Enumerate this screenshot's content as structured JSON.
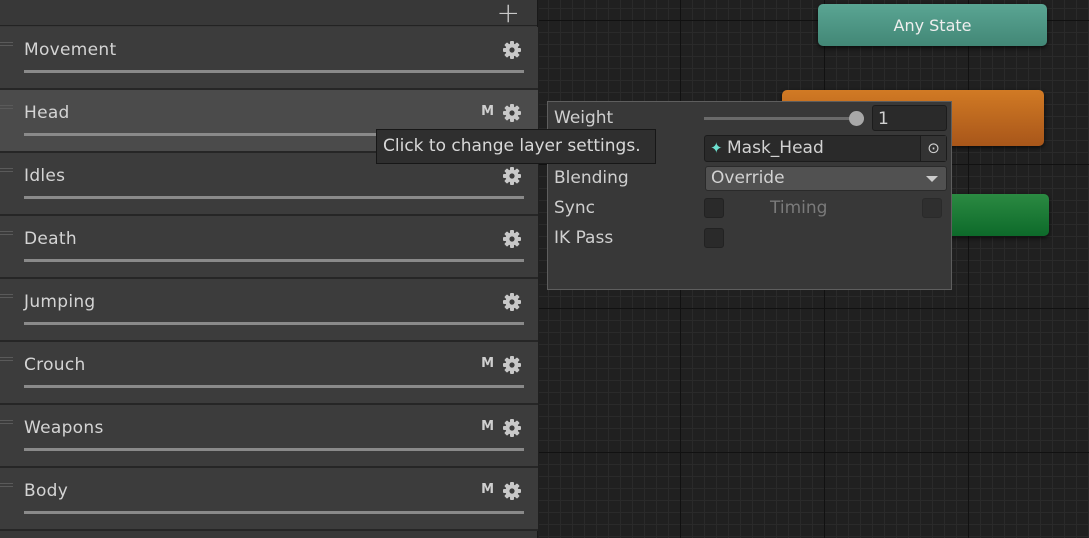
{
  "layers_panel": {
    "add_icon": "plus-icon",
    "layers": [
      {
        "name": "Movement",
        "mask": false,
        "weight": 1
      },
      {
        "name": "Head",
        "mask": true,
        "weight": 1,
        "selected": true
      },
      {
        "name": "Idles",
        "mask": false,
        "weight": 1
      },
      {
        "name": "Death",
        "mask": false,
        "weight": 1
      },
      {
        "name": "Jumping",
        "mask": false,
        "weight": 1
      },
      {
        "name": "Crouch",
        "mask": true,
        "weight": 1
      },
      {
        "name": "Weapons",
        "mask": true,
        "weight": 1
      },
      {
        "name": "Body",
        "mask": true,
        "weight": 1
      }
    ],
    "mask_badge": "M"
  },
  "tooltip": "Click to change layer settings.",
  "layer_settings": {
    "weight_label": "Weight",
    "weight_value": "1",
    "weight_fraction": 1,
    "mask_value": "Mask_Head",
    "blending_label": "Blending",
    "blending_value": "Override",
    "sync_label": "Sync",
    "timing_label": "Timing",
    "ik_pass_label": "IK Pass",
    "sync_checked": false,
    "timing_checked": false,
    "ik_pass_checked": false
  },
  "graph": {
    "any_state": "Any State",
    "colors": {
      "any_state": "#4f9a8b",
      "default_state": "#c2691d",
      "entry": "#137a34"
    }
  }
}
